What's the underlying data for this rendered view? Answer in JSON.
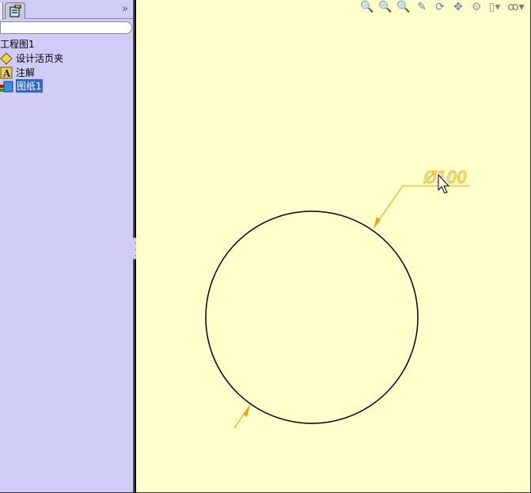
{
  "sidebar": {
    "tree": [
      {
        "label": "工程图1",
        "icon": "drawing-icon"
      },
      {
        "label": "设计活页夹",
        "icon": "design-binder-icon"
      },
      {
        "label": "注解",
        "icon": "annotations-icon"
      },
      {
        "label": "图纸1",
        "icon": "sheet-icon",
        "selected": true
      }
    ],
    "expand_label": "»"
  },
  "drawing": {
    "dimension_text": "Ø100",
    "annotation_color": "#f0a000",
    "background": "#ffffcc"
  },
  "toolbar": [
    "zoom-to-fit-icon",
    "zoom-area-icon",
    "zoom-in-out-icon",
    "zoom-selection-icon",
    "rotate-icon",
    "pan-icon",
    "display-style-icon",
    "view-orientation-icon",
    "hide-show-icon"
  ]
}
